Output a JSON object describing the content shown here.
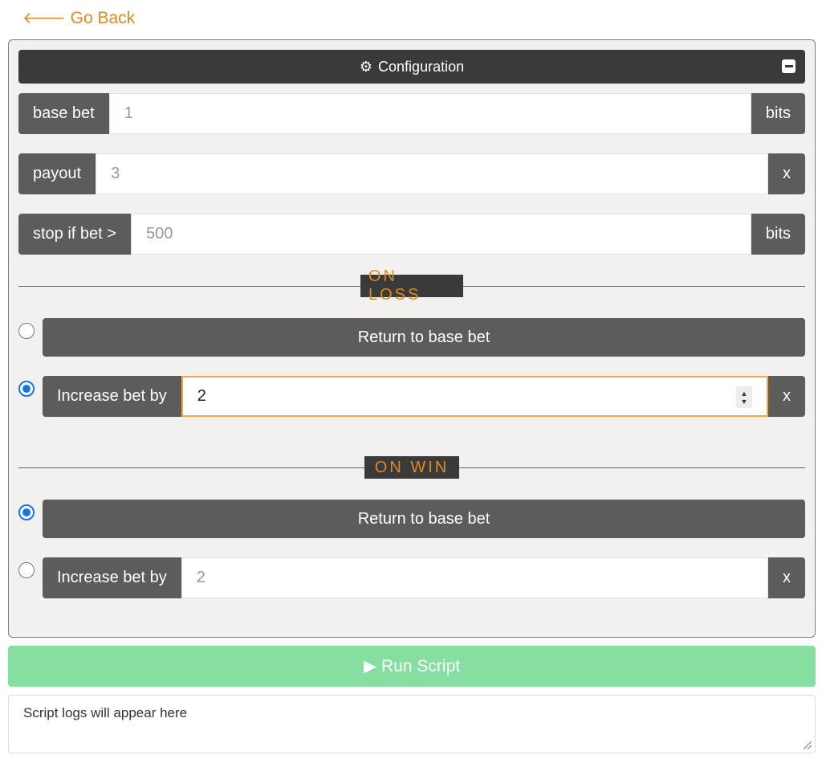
{
  "nav": {
    "back_arrow": "🡐",
    "back_label": "Go Back"
  },
  "config": {
    "title": "Configuration",
    "gear_icon": "⚙",
    "fields": [
      {
        "label": "base bet",
        "value": "1",
        "unit": "bits"
      },
      {
        "label": "payout",
        "value": "3",
        "unit": "x"
      },
      {
        "label": "stop if bet >",
        "value": "500",
        "unit": "bits"
      }
    ]
  },
  "on_loss": {
    "heading": "ON LOSS",
    "return_label": "Return to base bet",
    "return_selected": false,
    "increase_label": "Increase bet by",
    "increase_value": "2",
    "increase_unit": "x",
    "increase_selected": true
  },
  "on_win": {
    "heading": "ON WIN",
    "return_label": "Return to base bet",
    "return_selected": true,
    "increase_label": "Increase bet by",
    "increase_value": "2",
    "increase_unit": "x",
    "increase_selected": false
  },
  "run": {
    "icon": "▶",
    "label": "Run Script"
  },
  "logs": {
    "placeholder": "Script logs will appear here"
  },
  "colors": {
    "accent": "#e08a1e",
    "panel_dark": "#3a3a3a",
    "addon": "#5c5c5c",
    "run_green": "#86dfa1",
    "radio_blue": "#1a73e8"
  }
}
